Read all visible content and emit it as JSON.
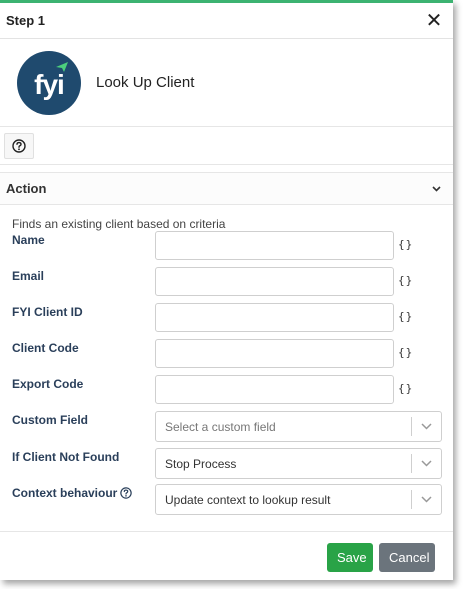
{
  "dialog": {
    "title": "Step 1",
    "close_icon": "close-icon"
  },
  "hero": {
    "logo_text": "fyi",
    "title": "Look Up Client"
  },
  "help": {
    "icon": "question-circle-icon"
  },
  "section": {
    "title": "Action",
    "expand_icon": "chevron-down-icon"
  },
  "form": {
    "description": "Finds an existing client based on criteria",
    "fields": [
      {
        "label": "Name",
        "value": ""
      },
      {
        "label": "Email",
        "value": ""
      },
      {
        "label": "FYI Client ID",
        "value": ""
      },
      {
        "label": "Client Code",
        "value": ""
      },
      {
        "label": "Export Code",
        "value": ""
      }
    ],
    "variable_icon": "curly-braces-icon",
    "variable_symbol": "{}",
    "custom_field": {
      "label": "Custom Field",
      "placeholder": "Select a custom field"
    },
    "client_not_found": {
      "label": "If Client Not Found",
      "value": "Stop Process"
    },
    "context_behaviour": {
      "label": "Context behaviour",
      "value": "Update context to lookup result"
    }
  },
  "footer": {
    "save_label": "Save",
    "cancel_label": "Cancel"
  },
  "colors": {
    "accent_top": "#3cb371",
    "logo_bg": "#1f4a6e",
    "save": "#29a347",
    "cancel": "#6b747c",
    "label": "#2a3f5a"
  }
}
